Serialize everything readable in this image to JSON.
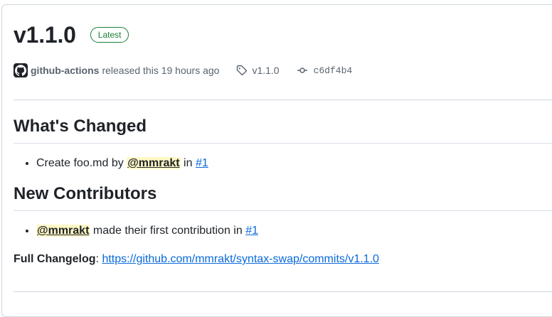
{
  "release": {
    "title": "v1.1.0",
    "badge": "Latest",
    "author": "github-actions",
    "released_text": "released this 19 hours ago",
    "tag": "v1.1.0",
    "commit": "c6df4b4"
  },
  "sections": {
    "whats_changed": {
      "heading": "What's Changed",
      "item_text_1": "Create foo.md by",
      "item_mention": "@mmrakt",
      "item_text_2": "in",
      "item_link": "#1"
    },
    "new_contributors": {
      "heading": "New Contributors",
      "item_mention": "@mmrakt",
      "item_text": "made their first contribution in",
      "item_link": "#1"
    }
  },
  "changelog": {
    "label": "Full Changelog",
    "separator": ":",
    "url": "https://github.com/mmrakt/syntax-swap/commits/v1.1.0"
  },
  "colors": {
    "accent_link": "#0969da",
    "badge_green": "#1a7f37",
    "mention_bg": "#fff8c5",
    "border": "#d0d7de"
  },
  "icons": {
    "avatar": "github-mark-icon",
    "tag": "tag-icon",
    "commit": "git-commit-icon"
  }
}
